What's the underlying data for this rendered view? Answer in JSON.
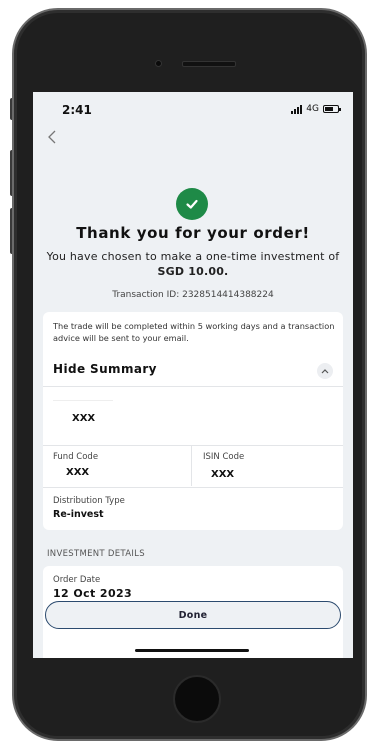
{
  "status_bar": {
    "time": "2:41",
    "network": "4G"
  },
  "confirmation": {
    "title": "Thank you for your order!",
    "message_prefix": "You have chosen to make a one-time investment of ",
    "amount": "SGD 10.00.",
    "transaction_id": "Transaction ID: 2328514414388224"
  },
  "summary": {
    "note": "The trade will be completed within 5 working days and a transaction advice will be sent to your email.",
    "toggle_label": "Hide Summary",
    "fund_name": "XXX",
    "fund_code_label": "Fund Code",
    "fund_code_value": "XXX",
    "isin_label": "ISIN Code",
    "isin_value": "XXX",
    "distribution_label": "Distribution Type",
    "distribution_value": "Re-invest"
  },
  "investment_details": {
    "section_title": "INVESTMENT DETAILS",
    "order_date_label": "Order Date",
    "order_date_value": "12 Oct 2023"
  },
  "actions": {
    "done_label": "Done"
  },
  "colors": {
    "success": "#1e8a47",
    "button_border": "#2b4a6e",
    "screen_bg": "#eef1f4"
  }
}
